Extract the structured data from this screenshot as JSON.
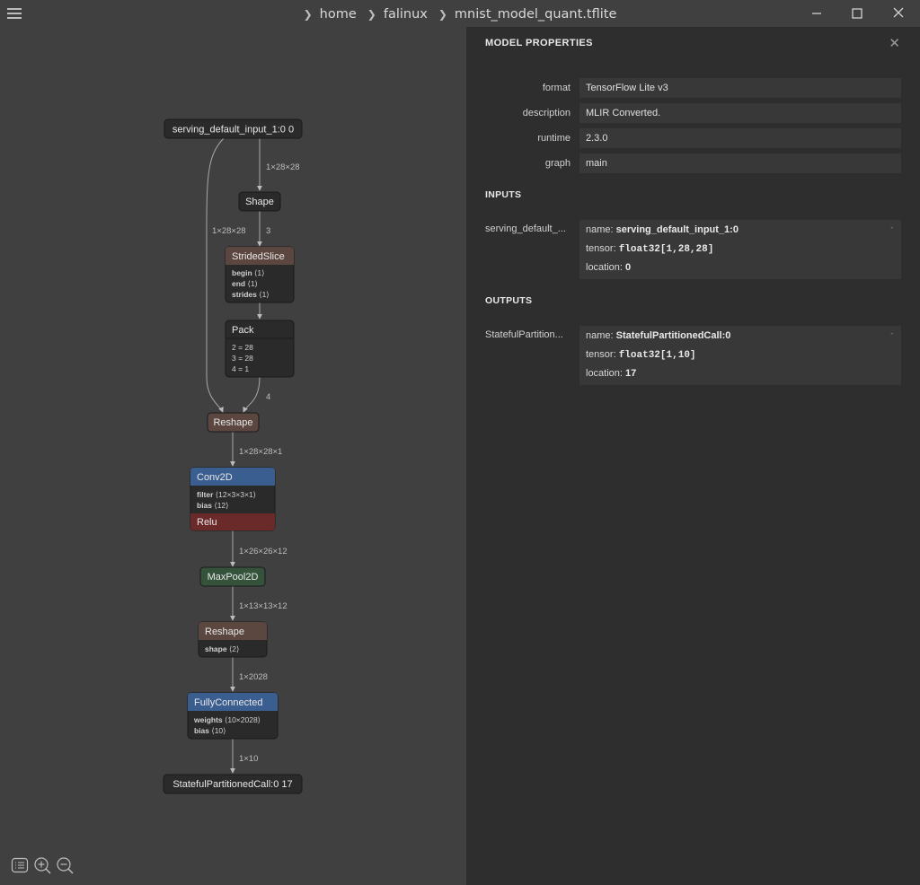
{
  "breadcrumb": {
    "items": [
      "home",
      "falinux",
      "mnist_model_quant.tflite"
    ]
  },
  "graph": {
    "nodes": {
      "input": "serving_default_input_1:0 0",
      "shape": "Shape",
      "strided_slice": {
        "title": "StridedSlice",
        "attrs": [
          {
            "key": "begin",
            "value": "⟨1⟩"
          },
          {
            "key": "end",
            "value": "⟨1⟩"
          },
          {
            "key": "strides",
            "value": "⟨1⟩"
          }
        ]
      },
      "pack": {
        "title": "Pack",
        "attrs": [
          "2 = 28",
          "3 = 28",
          "4 = 1"
        ]
      },
      "reshape1": "Reshape",
      "conv2d": {
        "title": "Conv2D",
        "attrs": [
          {
            "key": "filter",
            "value": "⟨12×3×3×1⟩"
          },
          {
            "key": "bias",
            "value": "⟨12⟩"
          }
        ],
        "activation": "Relu"
      },
      "maxpool": "MaxPool2D",
      "reshape2": {
        "title": "Reshape",
        "attrs": [
          {
            "key": "shape",
            "value": "⟨2⟩"
          }
        ]
      },
      "fully_connected": {
        "title": "FullyConnected",
        "attrs": [
          {
            "key": "weights",
            "value": "⟨10×2028⟩"
          },
          {
            "key": "bias",
            "value": "⟨10⟩"
          }
        ]
      },
      "output": "StatefulPartitionedCall:0 17"
    },
    "edges": {
      "input_shape": "1×28×28",
      "input_reshape": "1×28×28",
      "shape_slice": "3",
      "pack_reshape": "4",
      "reshape_conv": "1×28×28×1",
      "conv_pool": "1×26×26×12",
      "pool_reshape": "1×13×13×12",
      "reshape_fc": "1×2028",
      "fc_output": "1×10"
    }
  },
  "colors": {
    "background": "#404040",
    "node": "#2a2a2a",
    "node_border": "#1a1a1a",
    "layer_blue": "#3b5e91",
    "tensor_brown": "#5b4640",
    "activation_red": "#6b2a2a",
    "pool_green": "#34533a",
    "sidebar": "#2e2e2e"
  },
  "sidebar": {
    "title": "MODEL PROPERTIES",
    "properties": [
      {
        "label": "format",
        "value": "TensorFlow Lite v3"
      },
      {
        "label": "description",
        "value": "MLIR Converted."
      },
      {
        "label": "runtime",
        "value": "2.3.0"
      },
      {
        "label": "graph",
        "value": "main"
      }
    ],
    "inputs_title": "INPUTS",
    "input": {
      "label": "serving_default_...",
      "name_key": "name:",
      "name": "serving_default_input_1:0",
      "tensor_key": "tensor:",
      "tensor": "float32[1,28,28]",
      "location_key": "location:",
      "location": "0"
    },
    "outputs_title": "OUTPUTS",
    "output": {
      "label": "StatefulPartition...",
      "name_key": "name:",
      "name": "StatefulPartitionedCall:0",
      "tensor_key": "tensor:",
      "tensor": "float32[1,10]",
      "location_key": "location:",
      "location": "17"
    }
  }
}
